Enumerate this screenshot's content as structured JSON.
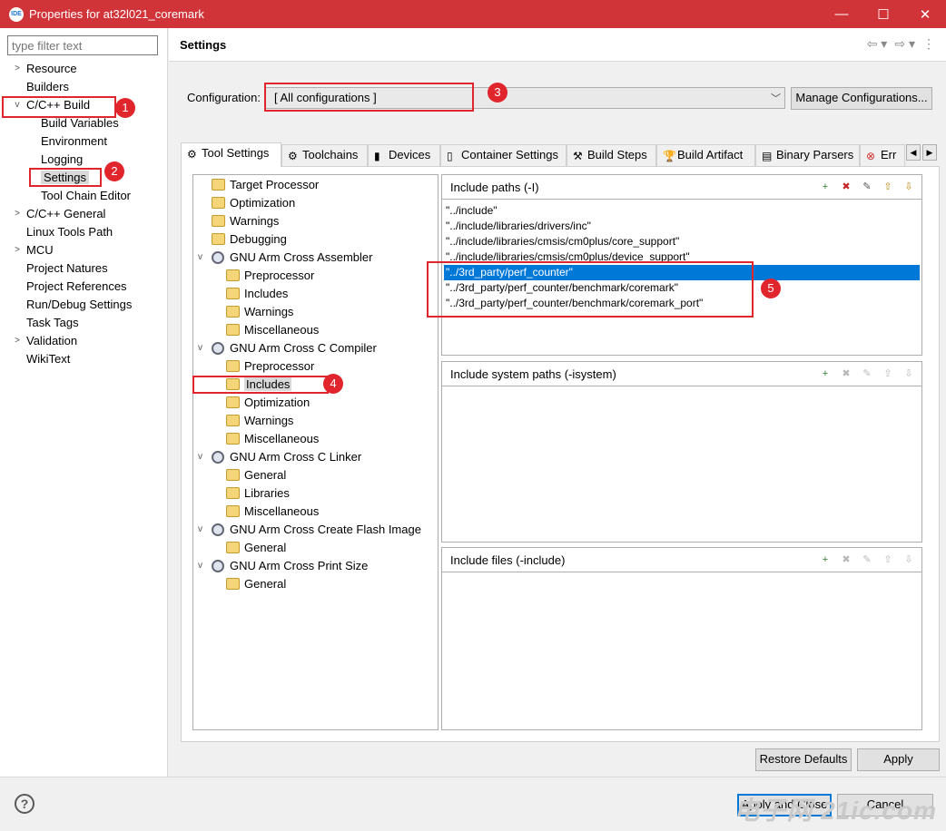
{
  "window": {
    "title": "Properties for at32l021_coremark",
    "minimize": "—",
    "maximize": "☐",
    "close": "✕"
  },
  "nav": {
    "filter_placeholder": "type filter text",
    "items": [
      {
        "label": "Resource",
        "twisty": ">"
      },
      {
        "label": "Builders",
        "twisty": ""
      },
      {
        "label": "C/C++ Build",
        "twisty": "v"
      },
      {
        "label": "Build Variables",
        "twisty": ""
      },
      {
        "label": "Environment",
        "twisty": ""
      },
      {
        "label": "Logging",
        "twisty": ""
      },
      {
        "label": "Settings",
        "twisty": ""
      },
      {
        "label": "Tool Chain Editor",
        "twisty": ""
      },
      {
        "label": "C/C++ General",
        "twisty": ">"
      },
      {
        "label": "Linux Tools Path",
        "twisty": ""
      },
      {
        "label": "MCU",
        "twisty": ">"
      },
      {
        "label": "Project Natures",
        "twisty": ""
      },
      {
        "label": "Project References",
        "twisty": ""
      },
      {
        "label": "Run/Debug Settings",
        "twisty": ""
      },
      {
        "label": "Task Tags",
        "twisty": ""
      },
      {
        "label": "Validation",
        "twisty": ">"
      },
      {
        "label": "WikiText",
        "twisty": ""
      }
    ]
  },
  "header": {
    "title": "Settings",
    "back": "⇦ ▾",
    "forward": "⇨ ▾",
    "menu": "⋮"
  },
  "config": {
    "label": "Configuration:",
    "value": "[ All configurations ]",
    "arrow": "﹀",
    "manage_button": "Manage Configurations..."
  },
  "tabs": [
    {
      "label": "Tool Settings",
      "icon": "⚙"
    },
    {
      "label": "Toolchains",
      "icon": "⚙"
    },
    {
      "label": "Devices",
      "icon": "▮"
    },
    {
      "label": "Container Settings",
      "icon": "▯"
    },
    {
      "label": "Build Steps",
      "icon": "⚒"
    },
    {
      "label": "Build Artifact",
      "icon": "🏆"
    },
    {
      "label": "Binary Parsers",
      "icon": "▤"
    },
    {
      "label": "Err",
      "icon": "⊗"
    }
  ],
  "tab_scroll": {
    "left": "◀",
    "right": "▶"
  },
  "tool_tree": [
    {
      "label": "Target Processor",
      "kind": "folder",
      "tw": ""
    },
    {
      "label": "Optimization",
      "kind": "folder",
      "tw": ""
    },
    {
      "label": "Warnings",
      "kind": "folder",
      "tw": ""
    },
    {
      "label": "Debugging",
      "kind": "folder",
      "tw": ""
    },
    {
      "label": "GNU Arm Cross Assembler",
      "kind": "tool",
      "tw": "v"
    },
    {
      "label": "Preprocessor",
      "kind": "folder",
      "tw": ""
    },
    {
      "label": "Includes",
      "kind": "folder",
      "tw": ""
    },
    {
      "label": "Warnings",
      "kind": "folder",
      "tw": ""
    },
    {
      "label": "Miscellaneous",
      "kind": "folder",
      "tw": ""
    },
    {
      "label": "GNU Arm Cross C Compiler",
      "kind": "tool",
      "tw": "v"
    },
    {
      "label": "Preprocessor",
      "kind": "folder",
      "tw": ""
    },
    {
      "label": "Includes",
      "kind": "folder",
      "tw": ""
    },
    {
      "label": "Optimization",
      "kind": "folder",
      "tw": ""
    },
    {
      "label": "Warnings",
      "kind": "folder",
      "tw": ""
    },
    {
      "label": "Miscellaneous",
      "kind": "folder",
      "tw": ""
    },
    {
      "label": "GNU Arm Cross C Linker",
      "kind": "tool",
      "tw": "v"
    },
    {
      "label": "General",
      "kind": "folder",
      "tw": ""
    },
    {
      "label": "Libraries",
      "kind": "folder",
      "tw": ""
    },
    {
      "label": "Miscellaneous",
      "kind": "folder",
      "tw": ""
    },
    {
      "label": "GNU Arm Cross Create Flash Image",
      "kind": "tool",
      "tw": "v"
    },
    {
      "label": "General",
      "kind": "folder",
      "tw": ""
    },
    {
      "label": "GNU Arm Cross Print Size",
      "kind": "tool",
      "tw": "v"
    },
    {
      "label": "General",
      "kind": "folder",
      "tw": ""
    }
  ],
  "include_paths": {
    "title": "Include paths (-I)",
    "items": [
      "\"../include\"",
      "\"../include/libraries/drivers/inc\"",
      "\"../include/libraries/cmsis/cm0plus/core_support\"",
      "\"../include/libraries/cmsis/cm0plus/device_support\"",
      "\"../3rd_party/perf_counter\"",
      "\"../3rd_party/perf_counter/benchmark/coremark\"",
      "\"../3rd_party/perf_counter/benchmark/coremark_port\""
    ]
  },
  "system_paths": {
    "title": "Include system paths (-isystem)"
  },
  "include_files": {
    "title": "Include files (-include)"
  },
  "panel_tools": {
    "add": "+",
    "delete": "✖",
    "edit": "✎",
    "up": "⇧",
    "down": "⇩"
  },
  "buttons": {
    "restore": "Restore Defaults",
    "apply": "Apply",
    "apply_close": "Apply and Close",
    "cancel": "Cancel"
  },
  "help": "?",
  "annotations": [
    "1",
    "2",
    "3",
    "4",
    "5"
  ],
  "watermark": "电子网 21ic.com"
}
